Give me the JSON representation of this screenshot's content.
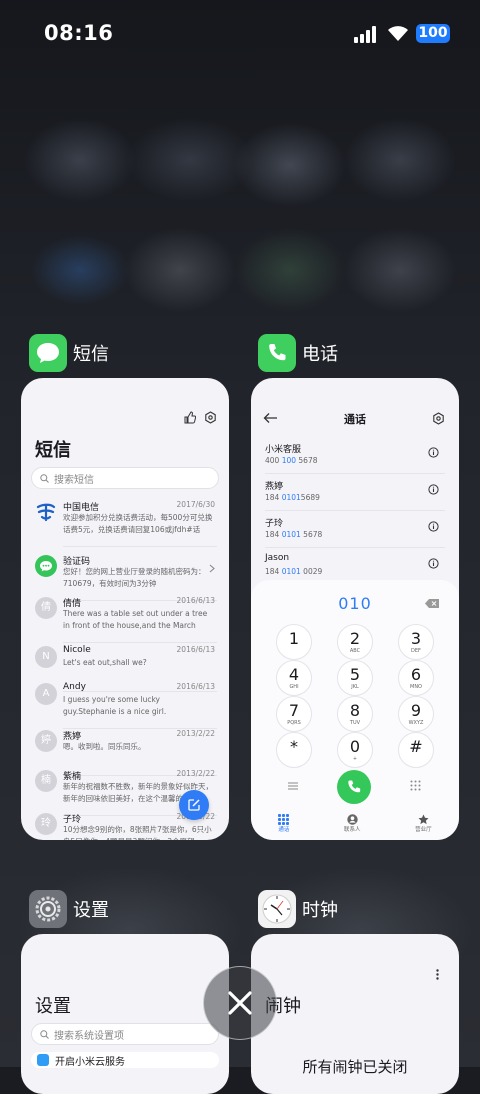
{
  "status_bar": {
    "time": "08:16",
    "battery": "100"
  },
  "cards": {
    "sms": {
      "app_name": "短信",
      "title": "短信",
      "search_placeholder": "搜索短信",
      "messages": [
        {
          "name": "中国电信",
          "date": "2017/6/30",
          "preview": "欢迎参加积分兑换话费活动，每500分可兑换话费5元，兑换话费请回复106或jfdh#话费…",
          "avatar": "telecom"
        },
        {
          "name": "验证码",
          "date": "",
          "preview": "您好！您的网上营业厅登录的随机密码为：710679，有效时间为3分钟",
          "avatar": "verify"
        },
        {
          "name": "倩倩",
          "date": "2016/6/13",
          "preview": "There was a table set out under a tree in front of the house,and the March Hare an…",
          "avatar": "倩"
        },
        {
          "name": "Nicole",
          "date": "2016/6/13",
          "preview": "Let's eat out,shall we?",
          "avatar": "N"
        },
        {
          "name": "Andy",
          "date": "2016/6/13",
          "preview": "I guess you're some lucky guy.Stephanie is a nice girl.",
          "avatar": "A"
        },
        {
          "name": "燕婷",
          "date": "2013/2/22",
          "preview": "嗯。收到啦。同乐同乐。",
          "avatar": "婷"
        },
        {
          "name": "紫楠",
          "date": "2013/2/22",
          "preview": "新年的祝福数不胜数，新年的景象好似昨天，新年的回味依旧美好，在这个温馨的新年…",
          "avatar": "楠"
        },
        {
          "name": "子玲",
          "date": "2013/2/22",
          "preview": "10分想念9别的你，8张照片7张是你，6只小鸟5只像你，4颗星星3颗闪你，2个愿望…",
          "avatar": "玲"
        }
      ]
    },
    "phone": {
      "app_name": "电话",
      "title": "通话",
      "contacts": [
        {
          "name": "小米客服",
          "num_pre": "400 ",
          "num_hl": "100",
          "num_post": " 5678"
        },
        {
          "name": "燕婷",
          "num_pre": "184 ",
          "num_hl": "0101",
          "num_post": "5689"
        },
        {
          "name": "子玲",
          "num_pre": "184 ",
          "num_hl": "0101",
          "num_post": " 5678"
        },
        {
          "name": "Jason",
          "num_pre": "184 ",
          "num_hl": "0101",
          "num_post": " 0029"
        }
      ],
      "dialed": "010",
      "keys": [
        {
          "d": "1",
          "l": ""
        },
        {
          "d": "2",
          "l": "ABC"
        },
        {
          "d": "3",
          "l": "DEF"
        },
        {
          "d": "4",
          "l": "GHI"
        },
        {
          "d": "5",
          "l": "JKL"
        },
        {
          "d": "6",
          "l": "MNO"
        },
        {
          "d": "7",
          "l": "PQRS"
        },
        {
          "d": "8",
          "l": "TUV"
        },
        {
          "d": "9",
          "l": "WXYZ"
        },
        {
          "d": "*",
          "l": ""
        },
        {
          "d": "0",
          "l": "+"
        },
        {
          "d": "#",
          "l": ""
        }
      ],
      "tabs": [
        "通话",
        "联系人",
        "营业厅"
      ]
    },
    "settings": {
      "app_name": "设置",
      "title": "设置",
      "search_placeholder": "搜索系统设置项",
      "first_item": "开启小米云服务"
    },
    "clock": {
      "app_name": "时钟",
      "title": "闹钟",
      "empty_text": "所有闹钟已关闭"
    }
  }
}
